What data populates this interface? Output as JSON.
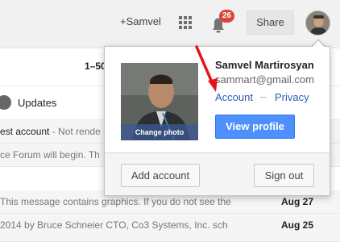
{
  "header": {
    "plus_name": "+Samvel",
    "notification_count": "26",
    "share_label": "Share",
    "apps_icon": "apps-grid-icon",
    "bell_icon": "notifications-bell-icon"
  },
  "inbox": {
    "range": "1–50",
    "updates_label": "Updates",
    "rows": [
      {
        "subject": "est account",
        "snippet": " - Not rende",
        "date": ""
      },
      {
        "subject": "",
        "snippet": "ce Forum will begin. Th",
        "date": ""
      },
      {
        "subject": "",
        "snippet": "This message contains graphics. If you do not see the",
        "date": "Aug 27"
      },
      {
        "subject": "",
        "snippet": "2014 by Bruce Schneier CTO, Co3 Systems, Inc. sch",
        "date": "Aug 25"
      }
    ]
  },
  "account_popup": {
    "name": "Samvel Martirosyan",
    "email": "sammart@gmail.com",
    "account_link": "Account",
    "separator": "–",
    "privacy_link": "Privacy",
    "change_photo": "Change photo",
    "view_profile": "View profile",
    "add_account": "Add account",
    "sign_out": "Sign out"
  },
  "colors": {
    "primary_button": "#4d90fe",
    "link": "#2a5db0",
    "badge": "#db4437",
    "annotation_arrow": "#e8121b"
  }
}
